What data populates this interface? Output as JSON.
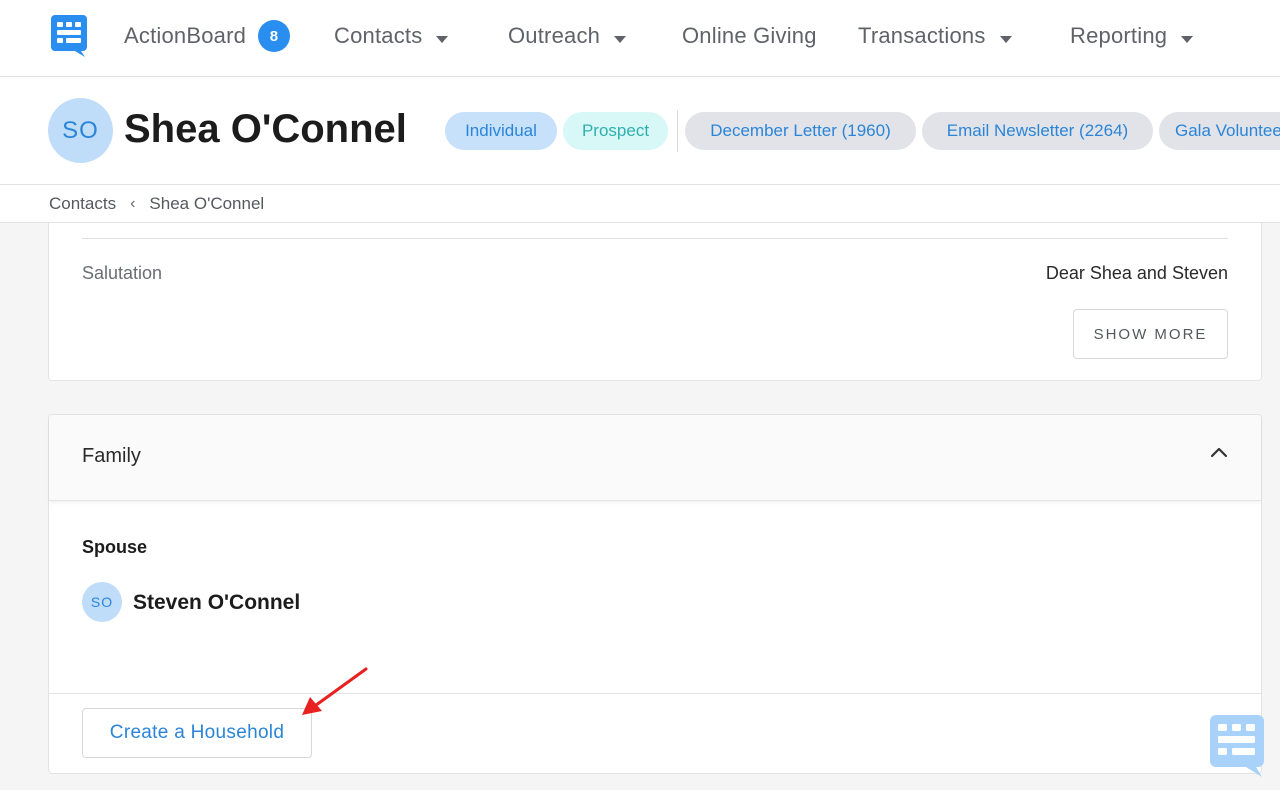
{
  "nav": {
    "items": [
      {
        "label": "ActionBoard",
        "badge": "8"
      },
      {
        "label": "Contacts"
      },
      {
        "label": "Outreach"
      },
      {
        "label": "Online Giving"
      },
      {
        "label": "Transactions"
      },
      {
        "label": "Reporting"
      }
    ]
  },
  "contact": {
    "initials": "SO",
    "name": "Shea O'Connel",
    "tags": [
      "Individual",
      "Prospect"
    ],
    "lists": [
      "December Letter (1960)",
      "Email Newsletter (2264)",
      "Gala Volunteer"
    ]
  },
  "breadcrumb": {
    "root": "Contacts",
    "current": "Shea O'Connel"
  },
  "details": {
    "salutation_label": "Salutation",
    "salutation_value": "Dear Shea and Steven",
    "show_more": "SHOW MORE"
  },
  "family": {
    "title": "Family",
    "spouse_label": "Spouse",
    "spouse_initials": "SO",
    "spouse_name": "Steven O'Connel",
    "create_household": "Create a Household"
  },
  "colors": {
    "accent": "#2a8ef0",
    "annotation_arrow": "#e8201f"
  }
}
